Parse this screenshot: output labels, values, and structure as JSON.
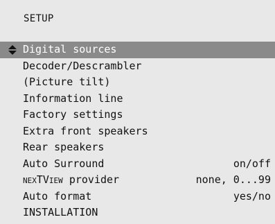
{
  "menu": {
    "title": "SETUP",
    "items": [
      {
        "label": "Digital sources",
        "value": "",
        "selected": true
      },
      {
        "label": "Decoder/Descrambler",
        "value": ""
      },
      {
        "label": "(Picture tilt)",
        "value": ""
      },
      {
        "label": "Information line",
        "value": ""
      },
      {
        "label": "Factory settings",
        "value": ""
      },
      {
        "label": "Extra front speakers",
        "value": ""
      },
      {
        "label": "Rear speakers",
        "value": ""
      },
      {
        "label": "Auto Surround",
        "value": "on/off"
      },
      {
        "label_prefix": "nexTView",
        "label_suffix": " provider",
        "value": "none, 0...99"
      },
      {
        "label": "Auto format",
        "value": "yes/no"
      },
      {
        "label": "INSTALLATION",
        "value": ""
      }
    ]
  },
  "icons": {
    "selection": "up-down-arrow-icon"
  },
  "colors": {
    "panel_background": "#e8e8e8",
    "highlight_background": "#8a8a8a",
    "highlight_text": "#ffffff",
    "text": "#111111"
  }
}
